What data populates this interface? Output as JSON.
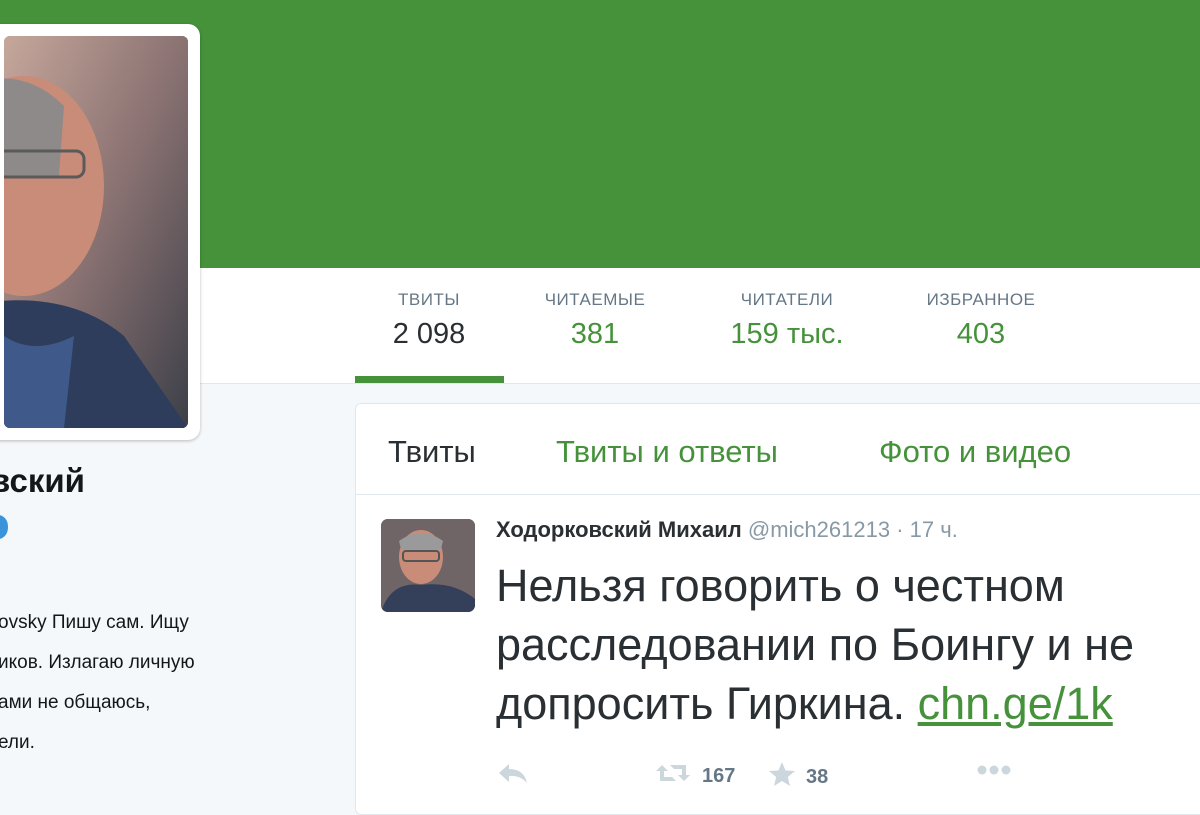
{
  "profile": {
    "name": "вский",
    "bio_lines": [
      "ovsky Пишу сам. Ищу",
      "иков. Излагаю личную",
      "ами не общаюсь,",
      "ели."
    ]
  },
  "stats": [
    {
      "label": "ТВИТЫ",
      "value": "2 098"
    },
    {
      "label": "ЧИТАЕМЫЕ",
      "value": "381"
    },
    {
      "label": "ЧИТАТЕЛИ",
      "value": "159 тыс."
    },
    {
      "label": "ИЗБРАННОЕ",
      "value": "403"
    }
  ],
  "tabs": [
    {
      "label": "Твиты"
    },
    {
      "label": "Твиты и ответы"
    },
    {
      "label": "Фото и видео"
    }
  ],
  "tweet": {
    "author": "Ходорковский Михаил",
    "handle": "@mich261213",
    "separator": "·",
    "time": "17 ч.",
    "text_lines": [
      "Нельзя говорить о честном",
      "расследовании по Боингу и не",
      "допросить Гиркина. "
    ],
    "link": "chn.ge/1k",
    "retweets": "167",
    "favorites": "38"
  },
  "colors": {
    "banner": "#45923b",
    "accent": "#45923b",
    "background": "#f5f8fa"
  },
  "icons": {
    "verified": "verified-badge-icon",
    "reply": "reply-icon",
    "retweet": "retweet-icon",
    "favorite": "star-icon",
    "more": "more-dots-icon"
  }
}
